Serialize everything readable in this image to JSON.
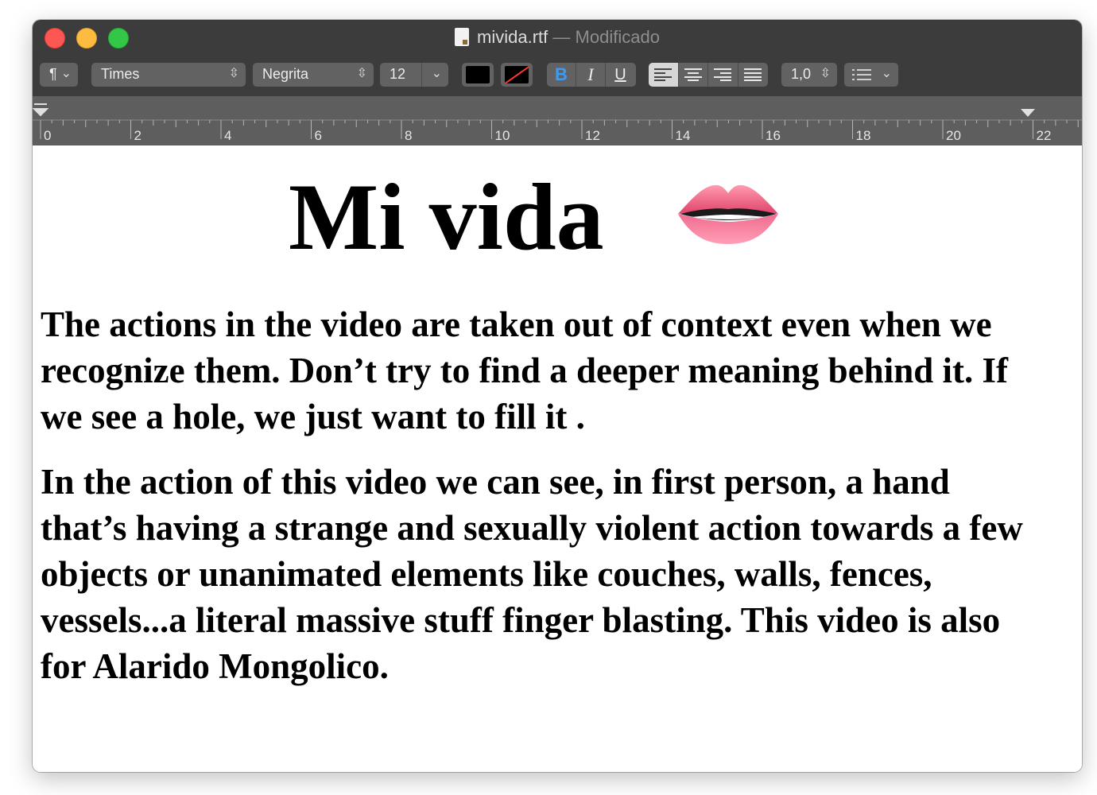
{
  "window": {
    "filename": "mivida.rtf",
    "separator": "—",
    "state": "Modificado"
  },
  "toolbar": {
    "paragraph_style": "¶",
    "font_family": "Times",
    "font_style": "Negrita",
    "font_size": "12",
    "text_color": "#000000",
    "bold_label": "B",
    "italic_label": "I",
    "underline_label": "U",
    "line_spacing": "1,0",
    "active_alignment": "left"
  },
  "ruler": {
    "labels": [
      "0",
      "2",
      "4",
      "6",
      "8",
      "10",
      "12",
      "14",
      "16",
      "18",
      "20",
      "22"
    ]
  },
  "document": {
    "title": "Mi vida",
    "emoji": "lips-icon",
    "paragraphs": [
      "The actions in the video are taken out of context even when we recognize them. Don’t try to find a deeper meaning behind it. If we see a hole, we just want to fill it .",
      "In the action of this video we can see, in first person, a hand that’s having a strange and sexually violent action towards a few objects or unanimated elements like couches, walls, fences, vessels...a literal massive stuff finger blasting. This video is also for Alarido Mongolico."
    ]
  }
}
